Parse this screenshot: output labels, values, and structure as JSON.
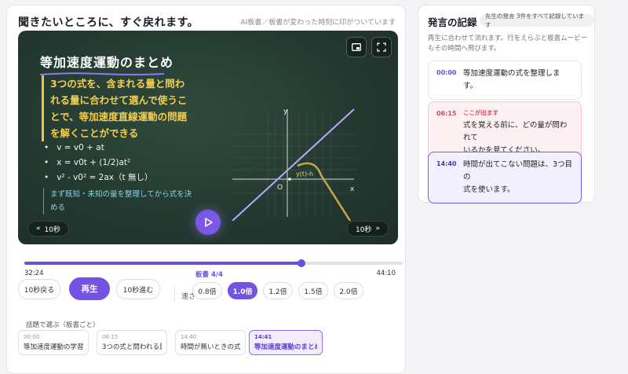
{
  "header": {
    "title": "聞きたいところに、すぐ戻れます。",
    "note": "AI板書／板書が変わった時刻に印がついています"
  },
  "board": {
    "title": "等加速度運動のまとめ",
    "highlight_lines": [
      "3つの式を、含まれる量と問わ",
      "れる量に合わせて選んで使うこ",
      "とで、等加速度直線運動の問題",
      "を解くことができる"
    ],
    "formulas": [
      {
        "text": "v = v0 + at"
      },
      {
        "text": "x = v0t + (1/2)at²"
      },
      {
        "text": "v² - v0² = 2ax（t 無し）"
      }
    ],
    "note_lines": [
      "まず既知・未知の量を整理してから式を決",
      "める"
    ],
    "graph": {
      "x_label": "x",
      "y_label": "y",
      "origin_label": "O",
      "curve_label": "y(t)-h"
    }
  },
  "player": {
    "skip_back_label": "10秒",
    "skip_forward_label": "10秒",
    "current_time": "32:24",
    "total_time": "44:10",
    "progress_fraction": 0.733,
    "board_position": "板書 4/4",
    "back_label": "10秒戻る",
    "play_label": "再生",
    "forward_label": "10秒進む",
    "speed_label": "速さ",
    "speeds": [
      "0.8倍",
      "1.0倍",
      "1.2倍",
      "1.5倍",
      "2.0倍"
    ],
    "selected_speed": "1.0倍"
  },
  "topics": {
    "label": "話題で選ぶ（板書ごと）",
    "items": [
      {
        "time": "00:00",
        "label": "等加速度運動の学習..."
      },
      {
        "time": "06:15",
        "label": "3つの式と問われる量"
      },
      {
        "time": "14:40",
        "label": "時間が無いときの式..."
      },
      {
        "time": "14:41",
        "label": "等加速度運動のまとめ"
      }
    ]
  },
  "transcript": {
    "title": "発言の記録",
    "badge": "先生の発言 3件をすべて記録しています",
    "description": "再生に合わせて流れます。行をえらぶと板書ムービーもその時間へ飛びます。",
    "entries": [
      {
        "time": "00:00",
        "tag": "",
        "lines": [
          "等加速度運動の式を整理しま",
          "す。"
        ]
      },
      {
        "time": "06:15",
        "tag": "ここが出ます",
        "lines": [
          "式を覚える前に、どの量が問われて",
          "いるかを見てください。"
        ]
      },
      {
        "time": "14:40",
        "tag": "",
        "lines": [
          "時間が出てこない問題は、3つ目の",
          "式を使います。"
        ]
      }
    ]
  },
  "colors": {
    "accent": "#7453e0",
    "board": "#243a31",
    "highlight": "#f4cf4f",
    "warn": "#e0456b"
  }
}
